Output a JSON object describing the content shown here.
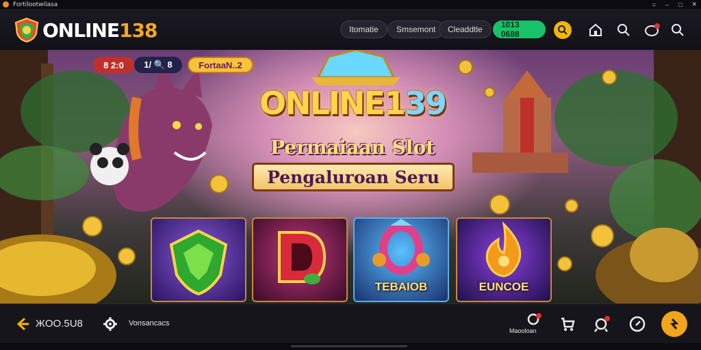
{
  "window": {
    "title": "Fortilootwilasa",
    "controls": [
      "=",
      "–",
      "□",
      "✕"
    ]
  },
  "header": {
    "logo_a": "ONLINE",
    "logo_b": "138",
    "nav": [
      "Itomatie",
      "Smsemont",
      "Cleaddtle",
      "1013 0688"
    ],
    "icons": [
      "search-icon",
      "home-icon",
      "search-icon",
      "chat-icon",
      "search-icon"
    ]
  },
  "hero": {
    "badge_left": "8 2:0",
    "badge_mid": "1/ 🔍 8",
    "badge_right": "FortaaN..2",
    "title_a": "ONLINE1",
    "title_b": "39",
    "subtitle": "Permaiaan Slot",
    "ribbon": "Pengaluroan Seru",
    "cards": [
      {
        "caption": "",
        "color": "#3a1c6a"
      },
      {
        "caption": "",
        "color": "#5a1040"
      },
      {
        "caption": "TEBAIOB",
        "color": "#1a3a7a"
      },
      {
        "caption": "EUNCOE",
        "color": "#3a1460"
      }
    ]
  },
  "bottom": {
    "balance": "ЖOO.5U8",
    "status": "Vonsancacs",
    "right_label": "Maooloan"
  },
  "colors": {
    "accent": "#f5a623",
    "green": "#18c26a",
    "yellow": "#f2b705"
  }
}
